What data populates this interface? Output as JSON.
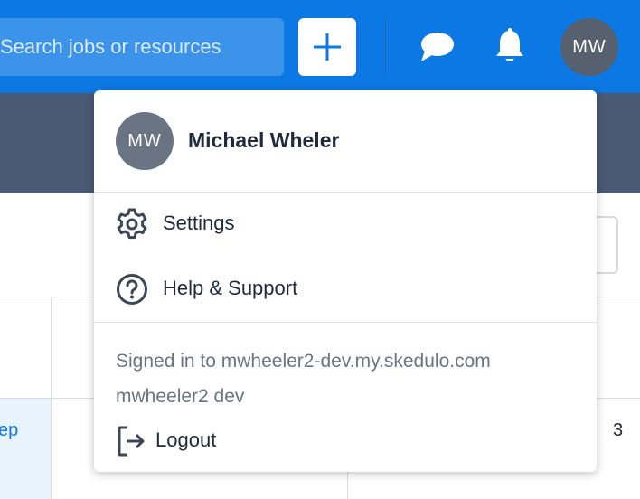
{
  "topbar": {
    "search_placeholder": "Search jobs or resources",
    "add_icon": "plus-icon",
    "chat_icon": "chat-bubble-icon",
    "notifications_icon": "bell-icon",
    "avatar_initials": "MW"
  },
  "background": {
    "cell_link_text": "ep",
    "cell_number": "3"
  },
  "user_menu": {
    "avatar_initials": "MW",
    "user_name": "Michael Wheler",
    "items": [
      {
        "label": "Settings",
        "icon": "gear-icon"
      },
      {
        "label": "Help & Support",
        "icon": "question-circle-icon"
      }
    ],
    "signed_in_text": "Signed in to mwheeler2-dev.my.skedulo.com",
    "org_name": "mwheeler2 dev",
    "logout_label": "Logout",
    "logout_icon": "logout-icon"
  },
  "colors": {
    "brand_blue": "#0b78e3",
    "subbar": "#4a5a74",
    "avatar_gray": "#56606f"
  }
}
